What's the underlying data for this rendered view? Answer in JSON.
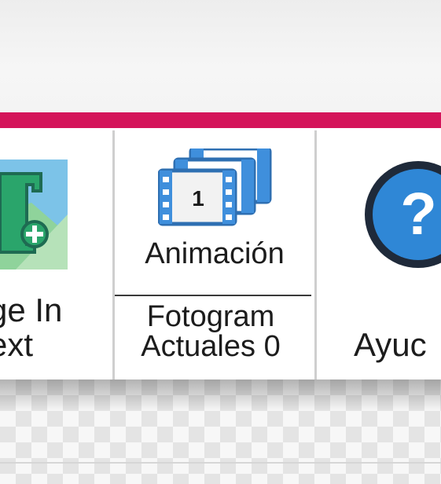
{
  "ribbon": {
    "image_in_text": {
      "label_line1": "ge In",
      "label_line2": "ext",
      "icon": "image-in-text-icon"
    },
    "animation": {
      "label": "Animación",
      "frame_number": "1",
      "status_line1": "Fotogram",
      "status_line2": "Actuales 0",
      "icon": "film-frames-icon"
    },
    "help": {
      "label": "Ayuc",
      "icon_glyph": "?",
      "icon": "help-circle-icon"
    }
  },
  "colors": {
    "accent": "#d4145a",
    "help_blue": "#2f87d6",
    "help_ring": "#1f2a3a",
    "film_blue": "#3f8fdc",
    "image_icon_green": "#2aa56b"
  }
}
